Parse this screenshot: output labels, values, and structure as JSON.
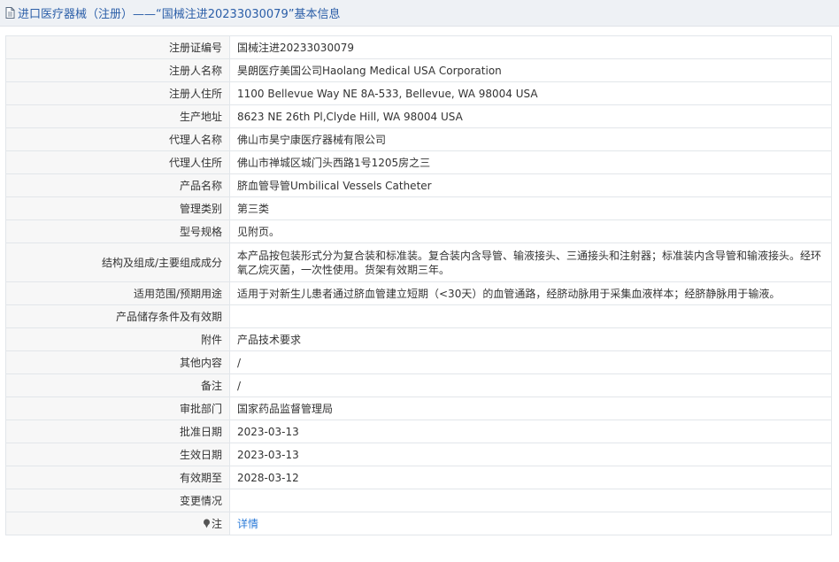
{
  "header": {
    "title": "进口医疗器械（注册）——“国械注进20233030079”基本信息",
    "icon": "document-icon"
  },
  "rows": [
    {
      "label": "注册证编号",
      "value": "国械注进20233030079"
    },
    {
      "label": "注册人名称",
      "value": "昊朗医疗美国公司Haolang Medical USA Corporation"
    },
    {
      "label": "注册人住所",
      "value": "1100 Bellevue Way NE 8A-533, Bellevue, WA 98004 USA"
    },
    {
      "label": "生产地址",
      "value": "8623 NE 26th Pl,Clyde Hill, WA 98004 USA"
    },
    {
      "label": "代理人名称",
      "value": "佛山市昊宁康医疗器械有限公司"
    },
    {
      "label": "代理人住所",
      "value": "佛山市禅城区城门头西路1号1205房之三"
    },
    {
      "label": "产品名称",
      "value": "脐血管导管Umbilical Vessels Catheter"
    },
    {
      "label": "管理类别",
      "value": "第三类"
    },
    {
      "label": "型号规格",
      "value": "见附页。"
    },
    {
      "label": "结构及组成/主要组成成分",
      "value": "本产品按包装形式分为复合装和标准装。复合装内含导管、输液接头、三通接头和注射器；标准装内含导管和输液接头。经环氧乙烷灭菌，一次性使用。货架有效期三年。"
    },
    {
      "label": "适用范围/预期用途",
      "value": "适用于对新生儿患者通过脐血管建立短期（<30天）的血管通路，经脐动脉用于采集血液样本；经脐静脉用于输液。"
    },
    {
      "label": "产品储存条件及有效期",
      "value": ""
    },
    {
      "label": "附件",
      "value": "产品技术要求"
    },
    {
      "label": "其他内容",
      "value": "/"
    },
    {
      "label": "备注",
      "value": "/"
    },
    {
      "label": "审批部门",
      "value": "国家药品监督管理局"
    },
    {
      "label": "批准日期",
      "value": "2023-03-13"
    },
    {
      "label": "生效日期",
      "value": "2023-03-13"
    },
    {
      "label": "有效期至",
      "value": "2028-03-12"
    },
    {
      "label": "变更情况",
      "value": ""
    }
  ],
  "note": {
    "label": "注",
    "icon": "pin-icon",
    "link_text": "详情"
  },
  "colors": {
    "title_text": "#2b5ea8",
    "title_bar_bg": "#eef1f5",
    "label_bg": "#f7f7f7",
    "border": "#e2e6ea",
    "link": "#2b7bd8"
  }
}
